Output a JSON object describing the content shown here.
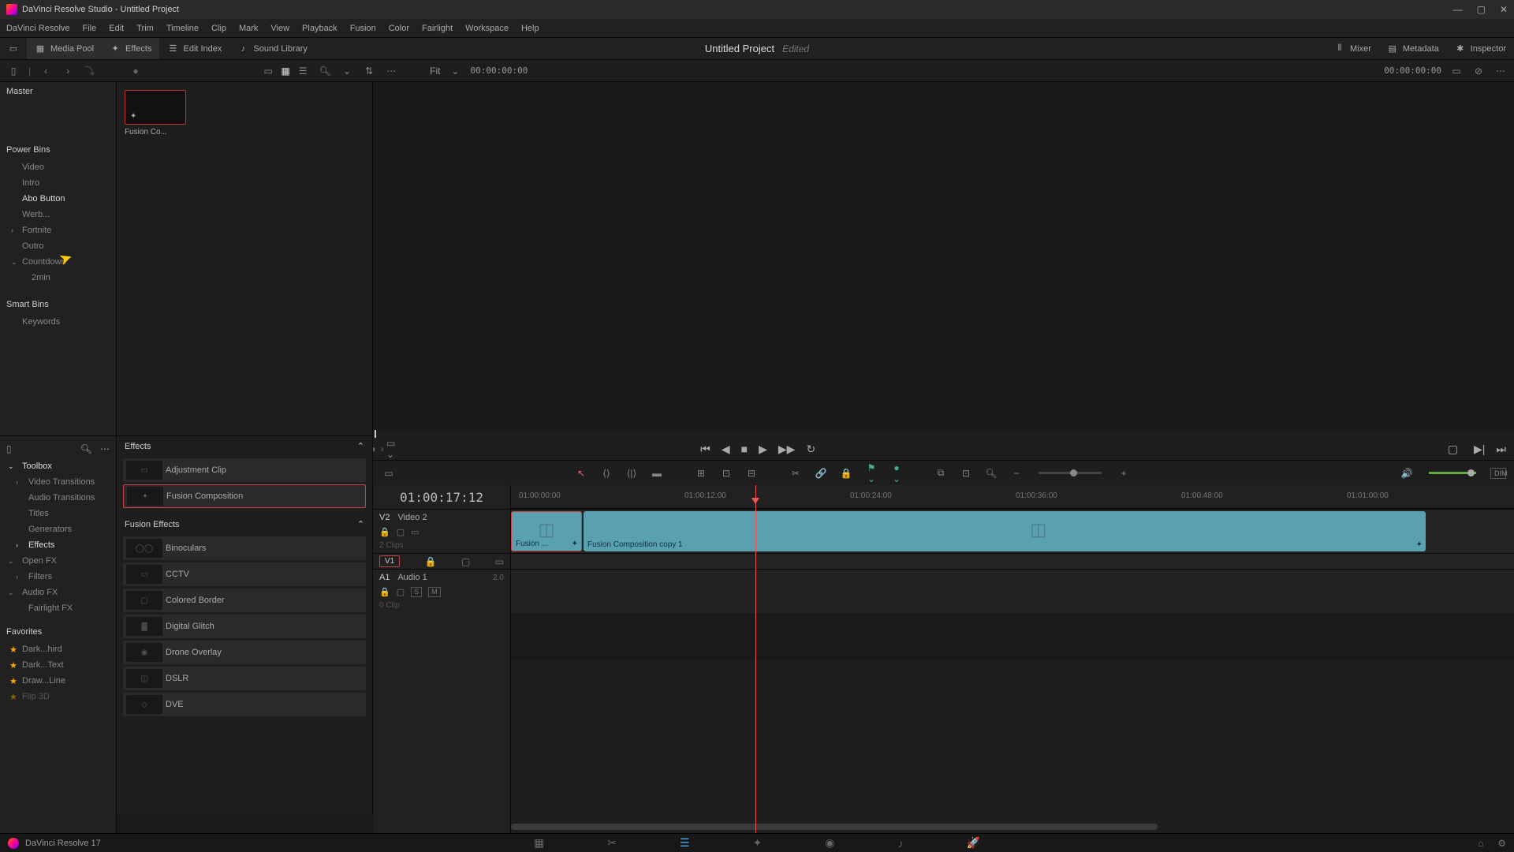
{
  "window": {
    "title": "DaVinci Resolve Studio - Untitled Project"
  },
  "menu": [
    "DaVinci Resolve",
    "File",
    "Edit",
    "Trim",
    "Timeline",
    "Clip",
    "Mark",
    "View",
    "Playback",
    "Fusion",
    "Color",
    "Fairlight",
    "Workspace",
    "Help"
  ],
  "toolbar": {
    "media_pool": "Media Pool",
    "effects": "Effects",
    "edit_index": "Edit Index",
    "sound_library": "Sound Library",
    "mixer": "Mixer",
    "metadata": "Metadata",
    "inspector": "Inspector"
  },
  "project": {
    "name": "Untitled Project",
    "status": "Edited"
  },
  "sec_toolbar": {
    "fit": "Fit",
    "tc_left": "00:00:00:00",
    "tc_right": "00:00:00:00"
  },
  "bins": {
    "master": "Master",
    "power_bins": "Power Bins",
    "items": [
      "Video",
      "Intro",
      "Abo Button",
      "Werb...",
      "Fortnite",
      "Outro",
      "Countdown",
      "2min"
    ],
    "smart_bins": "Smart Bins",
    "keywords": "Keywords"
  },
  "media": {
    "thumb_label": "Fusion Co..."
  },
  "fx_tree": {
    "toolbox": "Toolbox",
    "items1": [
      "Video Transitions",
      "Audio Transitions",
      "Titles",
      "Generators",
      "Effects"
    ],
    "openfx": "Open FX",
    "filters": "Filters",
    "audiofx": "Audio FX",
    "fairlight": "Fairlight FX",
    "favorites": "Favorites",
    "favs": [
      "Dark...hird",
      "Dark...Text",
      "Draw...Line",
      "Flip 3D"
    ]
  },
  "fx_list": {
    "effects_header": "Effects",
    "fusion_header": "Fusion Effects",
    "effects": [
      {
        "label": "Adjustment Clip"
      },
      {
        "label": "Fusion Composition"
      }
    ],
    "fusion": [
      {
        "label": "Binoculars"
      },
      {
        "label": "CCTV"
      },
      {
        "label": "Colored Border"
      },
      {
        "label": "Digital Glitch"
      },
      {
        "label": "Drone Overlay"
      },
      {
        "label": "DSLR"
      },
      {
        "label": "DVE"
      }
    ]
  },
  "timeline": {
    "tc": "01:00:17:12",
    "ruler": [
      "01:00:00:00",
      "01:00:12:00",
      "01:00:24:00",
      "01:00:36:00",
      "01:00:48:00",
      "01:01:00:00"
    ],
    "tracks": {
      "v2": {
        "id": "V2",
        "name": "Video 2",
        "clips_info": "2 Clips"
      },
      "v1": {
        "id": "V1"
      },
      "a1": {
        "id": "A1",
        "name": "Audio 1",
        "ch": "2.0",
        "clips_info": "0 Clip"
      }
    },
    "clip1_label": "Fusion ...",
    "clip2_label": "Fusion Composition copy 1"
  },
  "footer": {
    "version": "DaVinci Resolve 17"
  }
}
